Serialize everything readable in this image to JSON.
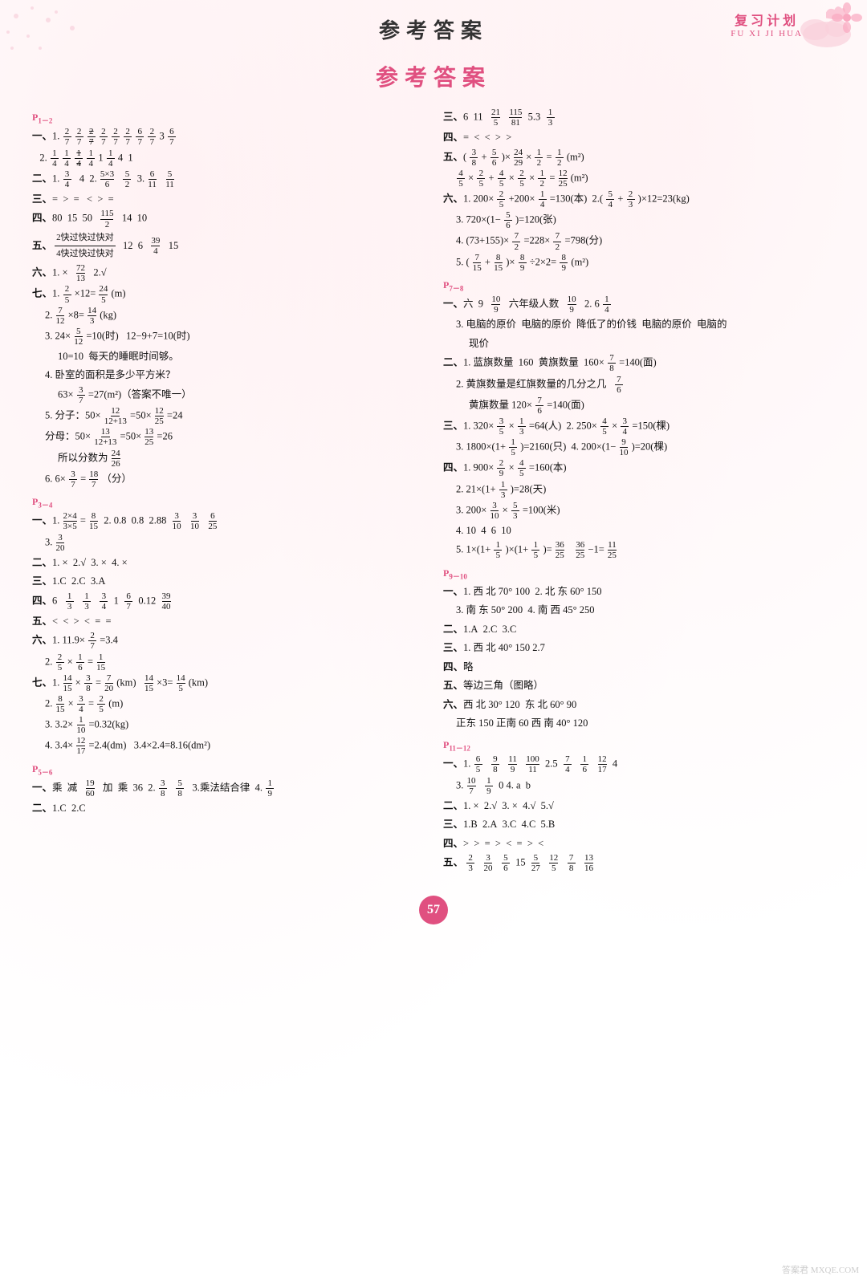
{
  "header": {
    "title": "参考答案",
    "review_plan_cn": "复习计划",
    "review_plan_en": "FU XI JI HUA"
  },
  "main_title": "参考答案",
  "page_number": "57",
  "watermark": "答案君 MXQE.COM"
}
